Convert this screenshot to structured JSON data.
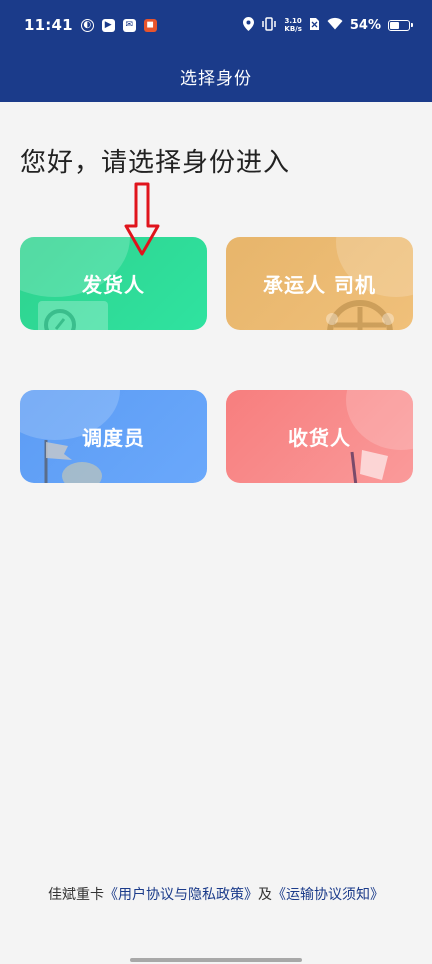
{
  "status_bar": {
    "time": "11:41",
    "net_speed_value": "3.10",
    "net_speed_unit": "KB/s",
    "battery_percent_text": "54%",
    "battery_level": 0.54
  },
  "header": {
    "title": "选择身份"
  },
  "greeting": "您好，请选择身份进入",
  "roles": [
    {
      "label": "发货人",
      "color": "#2fd89a"
    },
    {
      "label": "承运人 司机",
      "color": "#ecb971"
    },
    {
      "label": "调度员",
      "color": "#62a2f8"
    },
    {
      "label": "收货人",
      "color": "#f88b8b"
    }
  ],
  "agreement": {
    "brand": "佳斌重卡",
    "privacy_link": "《用户协议与隐私政策》",
    "conjunction": "及",
    "transport_link": "《运输协议须知》"
  },
  "colors": {
    "header_bg": "#1b3b8a",
    "page_bg": "#f4f4f4",
    "arrow": "#e0141c"
  }
}
